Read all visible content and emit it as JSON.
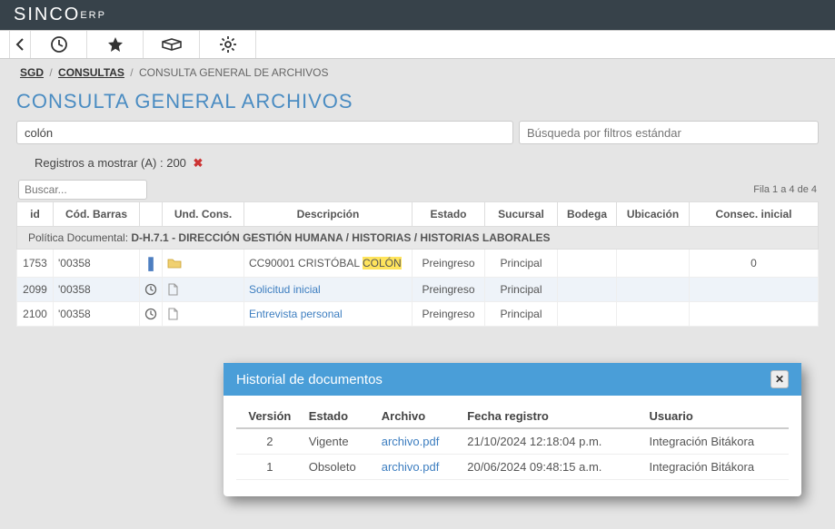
{
  "brand": {
    "name": "SINCO",
    "sub": "ERP"
  },
  "breadcrumb": {
    "root": "SGD",
    "sect": "CONSULTAS",
    "page": "CONSULTA GENERAL DE ARCHIVOS"
  },
  "title": "CONSULTA GENERAL ARCHIVOS",
  "search": {
    "value": "colón",
    "filter_placeholder": "Búsqueda por filtros estándar"
  },
  "records": {
    "label": "Registros a mostrar (A)",
    "value": "200"
  },
  "grid": {
    "search_placeholder": "Buscar...",
    "row_info": "Fila 1 a 4 de 4",
    "headers": [
      "id",
      "Cód. Barras",
      "",
      "Und. Cons.",
      "Descripción",
      "Estado",
      "Sucursal",
      "Bodega",
      "Ubicación",
      "Consec. inicial"
    ],
    "group_label": "Política Documental:",
    "group_value": "D-H.7.1 - DIRECCIÓN GESTIÓN HUMANA / HISTORIAS / HISTORIAS LABORALES",
    "rows": [
      {
        "id": "1753",
        "cod": "'00358",
        "icon": "pipe",
        "und": "folder",
        "desc_pre": "CC90001 CRISTÓBAL ",
        "desc_hl": "COLÓN",
        "link": false,
        "estado": "Preingreso",
        "sucursal": "Principal",
        "consec": "0"
      },
      {
        "id": "2099",
        "cod": "'00358",
        "icon": "clock",
        "und": "file",
        "desc": "Solicitud inicial",
        "link": true,
        "estado": "Preingreso",
        "sucursal": "Principal",
        "consec": ""
      },
      {
        "id": "2100",
        "cod": "'00358",
        "icon": "clock",
        "und": "file",
        "desc": "Entrevista personal",
        "link": true,
        "estado": "Preingreso",
        "sucursal": "Principal",
        "consec": ""
      }
    ]
  },
  "modal": {
    "title": "Historial de documentos",
    "headers": [
      "Versión",
      "Estado",
      "Archivo",
      "Fecha registro",
      "Usuario"
    ],
    "rows": [
      {
        "version": "2",
        "estado": "Vigente",
        "archivo": "archivo.pdf",
        "fecha": "21/10/2024 12:18:04 p.m.",
        "usuario": "Integración Bitákora"
      },
      {
        "version": "1",
        "estado": "Obsoleto",
        "archivo": "archivo.pdf",
        "fecha": "20/06/2024 09:48:15 a.m.",
        "usuario": "Integración Bitákora"
      }
    ]
  }
}
